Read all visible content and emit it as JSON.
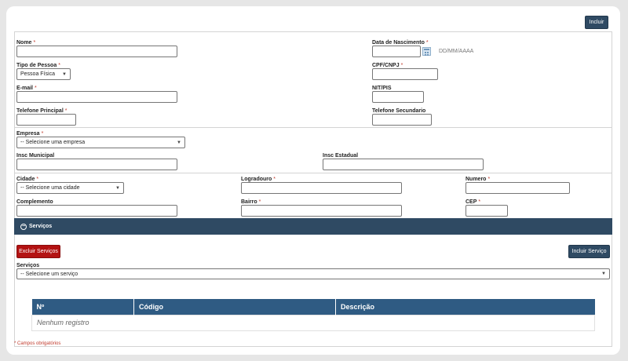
{
  "top_button": "Incluir",
  "form": {
    "nome_label": "Nome",
    "nascimento_label": "Data de Nascimento",
    "nascimento_hint": "DD/MM/AAAA",
    "tipo_pessoa_label": "Tipo de Pessoa",
    "tipo_pessoa_value": "Pessoa Física",
    "cpf_label": "CPF/CNPJ",
    "email_label": "E-mail",
    "nit_label": "NIT/PIS",
    "tel_principal_label": "Telefone Principal",
    "tel_secundario_label": "Telefone Secundario",
    "empresa_label": "Empresa",
    "empresa_value": "-- Selecione uma empresa",
    "insc_municipal_label": "Insc Municipal",
    "insc_estadual_label": "Insc Estadual",
    "cidade_label": "Cidade",
    "cidade_value": "-- Selecione uma cidade",
    "logradouro_label": "Logradouro",
    "numero_label": "Numero",
    "complemento_label": "Complemento",
    "bairro_label": "Bairro",
    "cep_label": "CEP",
    "required_mark": "*"
  },
  "servicos": {
    "bar_label": "Serviços",
    "excluir_button": "Excluir Serviços",
    "incluir_button": "Incluir Serviço",
    "field_label": "Serviços",
    "field_value": "-- Selecione um serviço",
    "table": {
      "headers": [
        "Nº",
        "Código",
        "Descrição"
      ],
      "empty": "Nenhum registro"
    }
  },
  "footer_note": "* Campos obrigatórios",
  "colors": {
    "primary": "#2f4a63",
    "table_header": "#2f5b83",
    "danger": "#b31212",
    "required": "#c0392b"
  }
}
